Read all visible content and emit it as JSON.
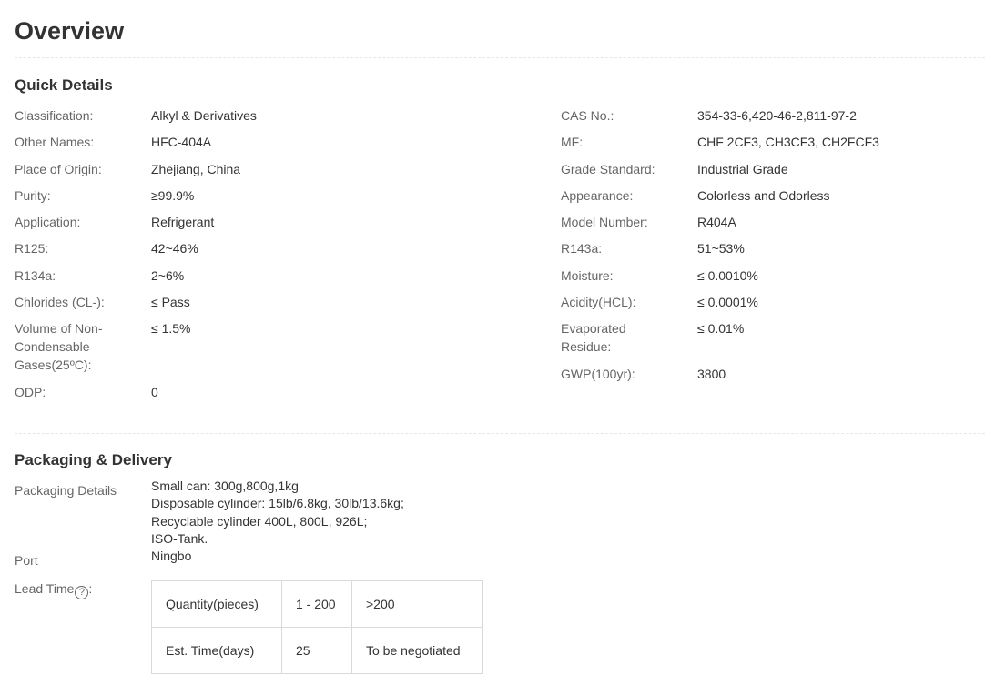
{
  "page_title": "Overview",
  "quick_details": {
    "title": "Quick Details",
    "left": [
      {
        "label": "Classification:",
        "value": "Alkyl & Derivatives"
      },
      {
        "label": "Other Names:",
        "value": "HFC-404A"
      },
      {
        "label": "Place of Origin:",
        "value": "Zhejiang, China"
      },
      {
        "label": "Purity:",
        "value": "≥99.9%"
      },
      {
        "label": "Application:",
        "value": "Refrigerant"
      },
      {
        "label": "R125:",
        "value": "42~46%"
      },
      {
        "label": "R134a:",
        "value": "2~6%"
      },
      {
        "label": "Chlorides (CL-):",
        "value": "≤ Pass"
      },
      {
        "label": "Volume of Non-Condensable Gases(25ºC):",
        "value": "≤ 1.5%"
      },
      {
        "label": "ODP:",
        "value": "0"
      }
    ],
    "right": [
      {
        "label": "CAS No.:",
        "value": "354-33-6,420-46-2,811-97-2"
      },
      {
        "label": "MF:",
        "value": "CHF 2CF3, CH3CF3, CH2FCF3"
      },
      {
        "label": "Grade Standard:",
        "value": "Industrial Grade"
      },
      {
        "label": "Appearance:",
        "value": "Colorless and Odorless"
      },
      {
        "label": "Model Number:",
        "value": "R404A"
      },
      {
        "label": "R143a:",
        "value": "51~53%"
      },
      {
        "label": "Moisture:",
        "value": "≤ 0.0010%"
      },
      {
        "label": "Acidity(HCL):",
        "value": "≤ 0.0001%"
      },
      {
        "label": "Evaporated Residue:",
        "value": "≤ 0.01%"
      },
      {
        "label": "GWP(100yr):",
        "value": "3800"
      }
    ]
  },
  "packaging": {
    "title": "Packaging & Delivery",
    "details_label": "Packaging Details",
    "details_lines": [
      "Small can: 300g,800g,1kg",
      "Disposable cylinder: 15lb/6.8kg, 30lb/13.6kg;",
      "Recyclable cylinder 400L, 800L, 926L;",
      "ISO-Tank."
    ],
    "port_label": "Port",
    "port_value": "Ningbo",
    "lead_time_label": "Lead Time",
    "help_icon": "?",
    "lead_table": {
      "rows": [
        [
          "Quantity(pieces)",
          "1 - 200",
          ">200"
        ],
        [
          "Est. Time(days)",
          "25",
          "To be negotiated"
        ]
      ]
    }
  }
}
